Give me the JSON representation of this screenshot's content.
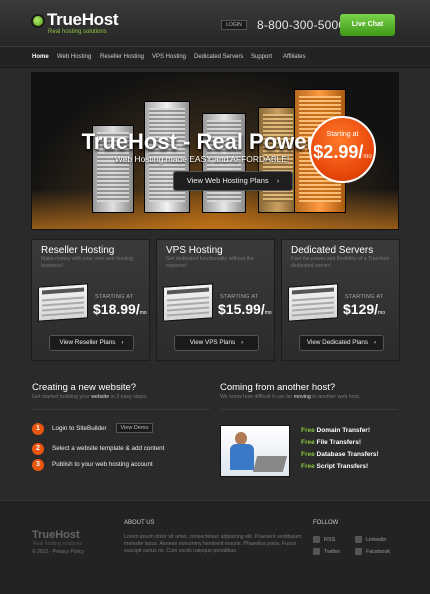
{
  "header": {
    "logo": "TrueHost",
    "tagline": "Real hosting solutions",
    "login_label": "LOGIN",
    "phone": "8-800-300-5000",
    "live_chat_label": "Live Chat"
  },
  "nav": {
    "items": [
      {
        "label": "Home",
        "active": true
      },
      {
        "label": "Web Hosting"
      },
      {
        "label": "Reseller Hosting"
      },
      {
        "label": "VPS Hosting"
      },
      {
        "label": "Dedicated Servers"
      },
      {
        "label": "Support"
      },
      {
        "label": "Affiliates"
      }
    ]
  },
  "hero": {
    "title": "TrueHost - Real Power!",
    "subtitle": "Web Hosting made EASY and AFFORDABLE!",
    "button_label": "View Web Hosting Plans",
    "badge_label": "Starting at",
    "badge_price": "$2.99/",
    "badge_unit": "mo"
  },
  "cards": [
    {
      "title": "Reseller Hosting",
      "desc": "Make money with your own web hosting business!",
      "starting": "STARTING AT",
      "price": "$18.99/",
      "unit": "mo",
      "button": "View Reseller Plans"
    },
    {
      "title": "VPS Hosting",
      "desc": "Get dedicated functionality without the expense!",
      "starting": "STARTING AT",
      "price": "$15.99/",
      "unit": "mo",
      "button": "View VPS Plans"
    },
    {
      "title": "Dedicated Servers",
      "desc": "Feel the power and flexibility of a TrueHost dedicated server!",
      "starting": "STARTING AT",
      "price": "$129/",
      "unit": "mo",
      "button": "View Dedicated Plans"
    }
  ],
  "create": {
    "title": "Creating a new website?",
    "subtitle_pre": "Get started building your ",
    "subtitle_hl": "website",
    "subtitle_post": " in 3 easy steps:",
    "steps": [
      {
        "num": "1",
        "text": "Login to SiteBuilder"
      },
      {
        "num": "2",
        "text": "Select a website template & add content"
      },
      {
        "num": "3",
        "text": "Publish to your web hosting account"
      }
    ],
    "demo_label": "View Demo"
  },
  "coming": {
    "title": "Coming from another host?",
    "subtitle_pre": "We know how difficult it can be ",
    "subtitle_hl": "moving",
    "subtitle_post": " to another web host.",
    "free_word": "Free",
    "transfers": [
      "Domain Transfer!",
      "File Transfers!",
      "Database Transfers!",
      "Script Transfers!"
    ]
  },
  "footer": {
    "logo": "TrueHost",
    "tagline": "Real hosting solutions",
    "copyright": "© 2012 · Privacy Policy",
    "about_title": "ABOUT US",
    "about_text": "Lorem ipsum dolor sit amet, consectetuer adipiscing elit. Praesent vestibulum molestie lacus. Aenean nonummy hendrerit mauris. Phasellus porta. Fusce suscipit varius mi. Cum sociis natoque penatibus.",
    "follow_title": "FOLLOW",
    "social": [
      "RSS",
      "Linkedin",
      "Twitter",
      "Facebook"
    ]
  },
  "colors": {
    "accent_green": "#8dc63f",
    "accent_orange": "#e8560f",
    "background": "#2a2a2a"
  }
}
